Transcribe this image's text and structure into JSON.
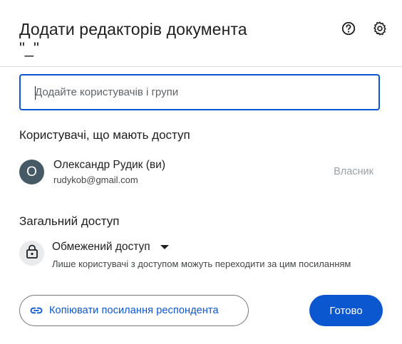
{
  "dialog": {
    "title": "Додати редакторів документа",
    "subtitle": "\"_\"",
    "help_icon": "help-circle-icon",
    "settings_icon": "gear-icon"
  },
  "search": {
    "placeholder": "Додайте користувачів і групи",
    "value": ""
  },
  "users_section": {
    "title": "Користувачі, що мають доступ",
    "users": [
      {
        "avatar_letter": "О",
        "avatar_color": "#455a64",
        "name": "Олександр Рудик (ви)",
        "email": "rudykob@gmail.com",
        "role": "Власник"
      }
    ]
  },
  "general_access": {
    "title": "Загальний доступ",
    "icon": "lock-icon",
    "selected": "Обмежений доступ",
    "description": "Лише користувачі з доступом можуть переходити за цим посиланням"
  },
  "footer": {
    "copy_link_label": "Копіювати посилання респондента",
    "copy_link_icon": "link-icon",
    "done_label": "Готово"
  },
  "colors": {
    "accent": "#0b57d0",
    "text": "#1f1f1f",
    "muted": "#444746",
    "disabled": "#9aa0a6"
  }
}
